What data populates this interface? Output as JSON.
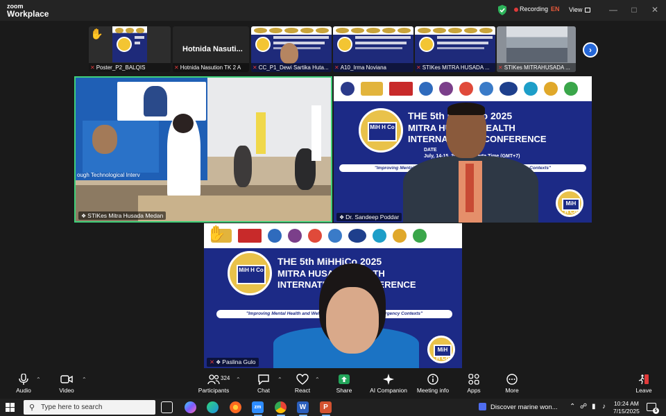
{
  "titlebar": {
    "brand_small": "zoom",
    "brand_large": "Workplace",
    "recording": "Recording",
    "language": "EN",
    "view": "View"
  },
  "strip": {
    "tiles": [
      {
        "name": "Poster_P2_BALQIS"
      },
      {
        "name": "Hotnida Nasution TK 2 A",
        "display_name": "Hotnida  Nasuti..."
      },
      {
        "name": "CC_P1_Dewi Sartika Huta..."
      },
      {
        "name": "A10_Irma Noviana"
      },
      {
        "name": "STIKes MITRA HUSADA ..."
      },
      {
        "name": "STIKes MITRAHUSADA ..."
      }
    ]
  },
  "tiles": {
    "room": {
      "name": "STIKes Mitra Husada Medan"
    },
    "speaker": {
      "name": "Dr. Sandeep Poddar"
    },
    "bottom": {
      "name": "Paslina Gulo"
    }
  },
  "banner": {
    "title_line1": "THE 5th MiHHiCo 2025",
    "title_line2": "MITRA HUSADA HEALTH",
    "title_line3": "INTERNATIONAL CONFERENCE",
    "date_label": "DATE",
    "date_value": "July, 14-15, 2025 — Jakarta Time (GMT+7)",
    "quote": "\"Improving Mental Health and Well-Being ... Interventions in Emergency Contexts\"",
    "room_caption": "ough Technological Interv"
  },
  "toolbar": {
    "audio": "Audio",
    "video": "Video",
    "participants": "Participants",
    "participants_count": "324",
    "chat": "Chat",
    "react": "React",
    "share": "Share",
    "ai_companion": "AI Companion",
    "meeting_info": "Meeting info",
    "apps": "Apps",
    "more": "More",
    "leave": "Leave"
  },
  "taskbar": {
    "search_placeholder": "Type here to search",
    "discover": "Discover marine won...",
    "time": "10:24 AM",
    "date": "7/15/2025",
    "notifications": "5"
  },
  "colors": {
    "active_speaker_border": "#3fd07a",
    "share_green": "#23a55a",
    "recording_red": "#e03a3a",
    "banner_navy": "#1c2a86"
  }
}
